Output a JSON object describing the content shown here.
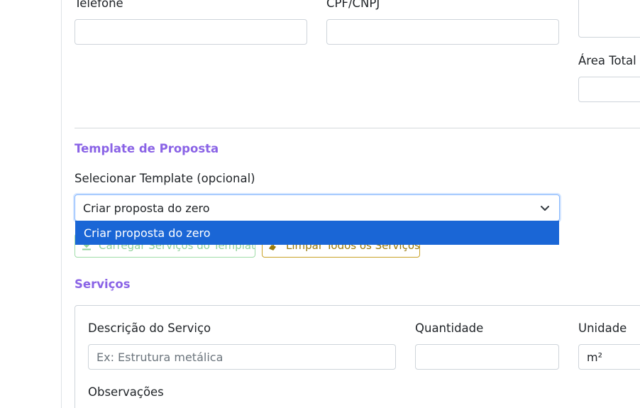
{
  "client": {
    "phone_label": "Telefone",
    "cpf_label": "CPF/CNPJ",
    "area_label": "Área Total"
  },
  "template_section": {
    "title": "Template de Proposta",
    "select_label": "Selecionar Template (opcional)",
    "selected": "Criar proposta do zero",
    "options": [
      "Criar proposta do zero"
    ],
    "load_button": "Carregar Serviços do Template",
    "clear_button": "Limpar Todos os Serviços"
  },
  "services_section": {
    "title": "Serviços",
    "description_label": "Descrição do Serviço",
    "description_placeholder": "Ex: Estrutura metálica",
    "quantity_label": "Quantidade",
    "unit_label": "Unidade",
    "unit_value": "m²",
    "notes_label": "Observações"
  },
  "colors": {
    "section_title": "#8a63e6",
    "dropdown_highlight": "#1a66d6",
    "success_outline": "#9fdca8",
    "warning_outline": "#c9a227"
  }
}
